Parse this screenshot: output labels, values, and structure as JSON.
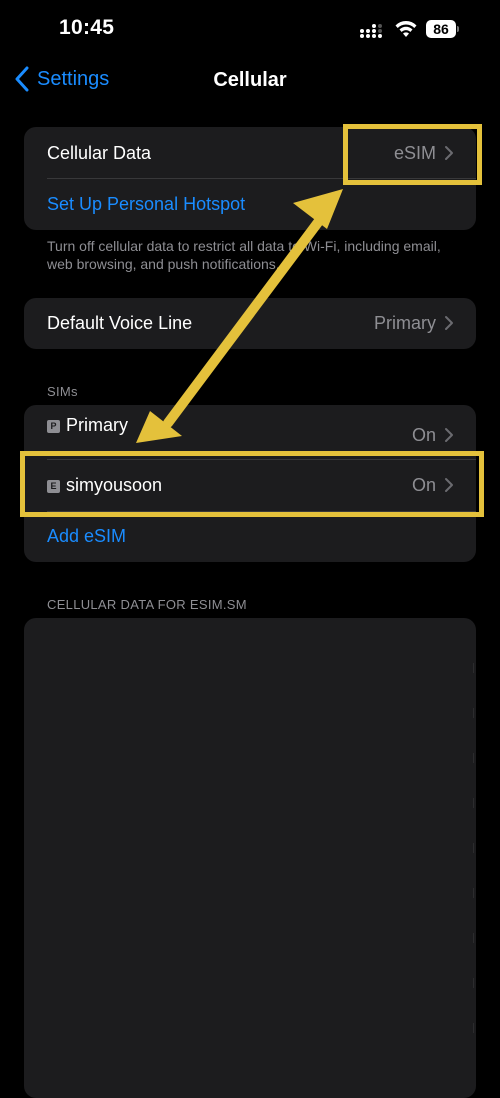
{
  "status_bar": {
    "time": "10:45",
    "battery": "86"
  },
  "nav": {
    "back_label": "Settings",
    "title": "Cellular"
  },
  "cellular": {
    "cellular_data_label": "Cellular Data",
    "cellular_data_value": "eSIM",
    "hotspot_label": "Set Up Personal Hotspot",
    "footnote": "Turn off cellular data to restrict all data to Wi-Fi, including email, web browsing, and push notifications."
  },
  "voice": {
    "label": "Default Voice Line",
    "value": "Primary"
  },
  "sims": {
    "header": "SIMs",
    "items": [
      {
        "badge": "P",
        "name": "Primary",
        "value": "On"
      },
      {
        "badge": "E",
        "name": "simyousoon",
        "value": "On"
      }
    ],
    "add_label": "Add eSIM"
  },
  "data_section": {
    "header": "CELLULAR DATA FOR ESIM.SM"
  },
  "colors": {
    "accent": "#1a8cff",
    "highlight": "#e4c13b",
    "card": "#1c1c1e",
    "secondary_text": "#8e8e93"
  }
}
